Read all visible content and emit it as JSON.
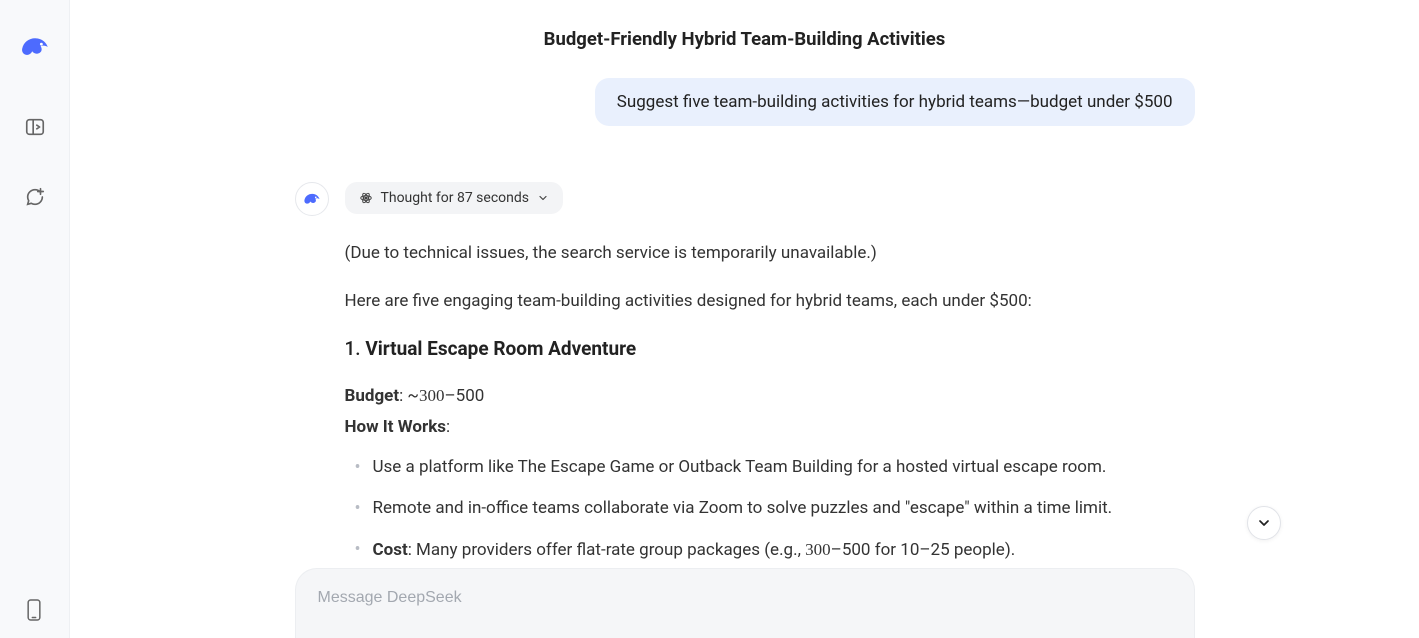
{
  "sidebar": {
    "logo_name": "whale-logo",
    "icons": {
      "toggle": "panel-toggle-icon",
      "new_chat": "new-chat-icon",
      "mobile": "phone-icon"
    }
  },
  "header": {
    "title": "Budget-Friendly Hybrid Team-Building Activities"
  },
  "conversation": {
    "user_message": "Suggest five team-building activities for hybrid teams—budget under $500",
    "thought_label": "Thought for 87 seconds",
    "notice": "(Due to technical issues, the search service is temporarily unavailable.)",
    "intro": "Here are five engaging team-building activities designed for hybrid teams, each under $500:",
    "item1": {
      "number": "1. ",
      "title": "Virtual Escape Room Adventure",
      "budget_label": "Budget",
      "budget_value_pre": ": ~",
      "budget_num": "300",
      "budget_value_post": "–500",
      "how_label": "How It Works",
      "how_colon": ":",
      "bullets": [
        "Use a platform like The Escape Game or Outback Team Building for a hosted virtual escape room.",
        "Remote and in-office teams collaborate via Zoom to solve puzzles and \"escape\" within a time limit."
      ],
      "cost_label": "Cost",
      "cost_pre": ": Many providers offer flat-rate group packages (e.g., ",
      "cost_num": "300",
      "cost_post": "–500 for 10–25 people)."
    }
  },
  "input": {
    "placeholder": "Message DeepSeek"
  },
  "colors": {
    "brand": "#4d6bfe",
    "user_bubble_bg": "#e9f0fd",
    "pill_bg": "#f3f4f6",
    "input_bg": "#f5f6f8"
  }
}
